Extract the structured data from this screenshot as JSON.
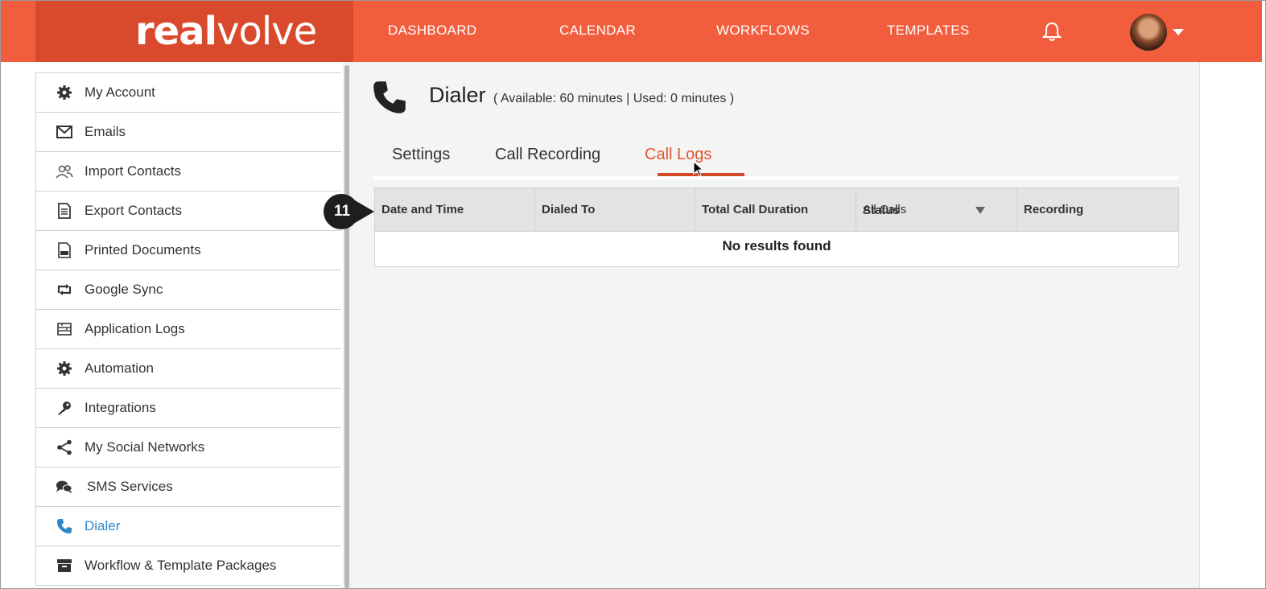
{
  "brand": {
    "logo_bold": "real",
    "logo_light": "volve",
    "primary_color": "#f25d3e",
    "logo_bg_color": "#d9492c"
  },
  "nav": {
    "items": [
      {
        "label": "DASHBOARD"
      },
      {
        "label": "CALENDAR"
      },
      {
        "label": "WORKFLOWS"
      },
      {
        "label": "TEMPLATES"
      }
    ],
    "bell_icon": "bell-icon",
    "avatar_icon": "user-avatar"
  },
  "sidebar": {
    "items": [
      {
        "label": "My Account",
        "icon": "gear-icon"
      },
      {
        "label": "Emails",
        "icon": "envelope-icon"
      },
      {
        "label": "Import Contacts",
        "icon": "users-icon"
      },
      {
        "label": "Export Contacts",
        "icon": "document-icon"
      },
      {
        "label": "Printed Documents",
        "icon": "pdf-icon"
      },
      {
        "label": "Google Sync",
        "icon": "sync-icon"
      },
      {
        "label": "Application Logs",
        "icon": "log-icon"
      },
      {
        "label": "Automation",
        "icon": "gear-icon"
      },
      {
        "label": "Integrations",
        "icon": "key-icon"
      },
      {
        "label": "My Social Networks",
        "icon": "share-icon"
      },
      {
        "label": "SMS Services",
        "icon": "chat-icon"
      },
      {
        "label": "Dialer",
        "icon": "phone-icon",
        "active": true
      },
      {
        "label": "Workflow & Template Packages",
        "icon": "archive-icon"
      }
    ],
    "active_color": "#2f86c8"
  },
  "page": {
    "title": "Dialer",
    "subtitle": "( Available: 60 minutes | Used: 0 minutes )",
    "tabs": [
      {
        "label": "Settings"
      },
      {
        "label": "Call Recording"
      },
      {
        "label": "Call Logs",
        "active": true
      }
    ],
    "active_tab_color": "#e2552f"
  },
  "table": {
    "columns": [
      {
        "label": "Date and Time"
      },
      {
        "label": "Dialed To"
      },
      {
        "label": "Total Call Duration"
      },
      {
        "label": "Status"
      },
      {
        "label": "Recording"
      }
    ],
    "status_filter": "All Calls",
    "empty_message": "No results found"
  },
  "annotation": {
    "step_number": "11"
  }
}
